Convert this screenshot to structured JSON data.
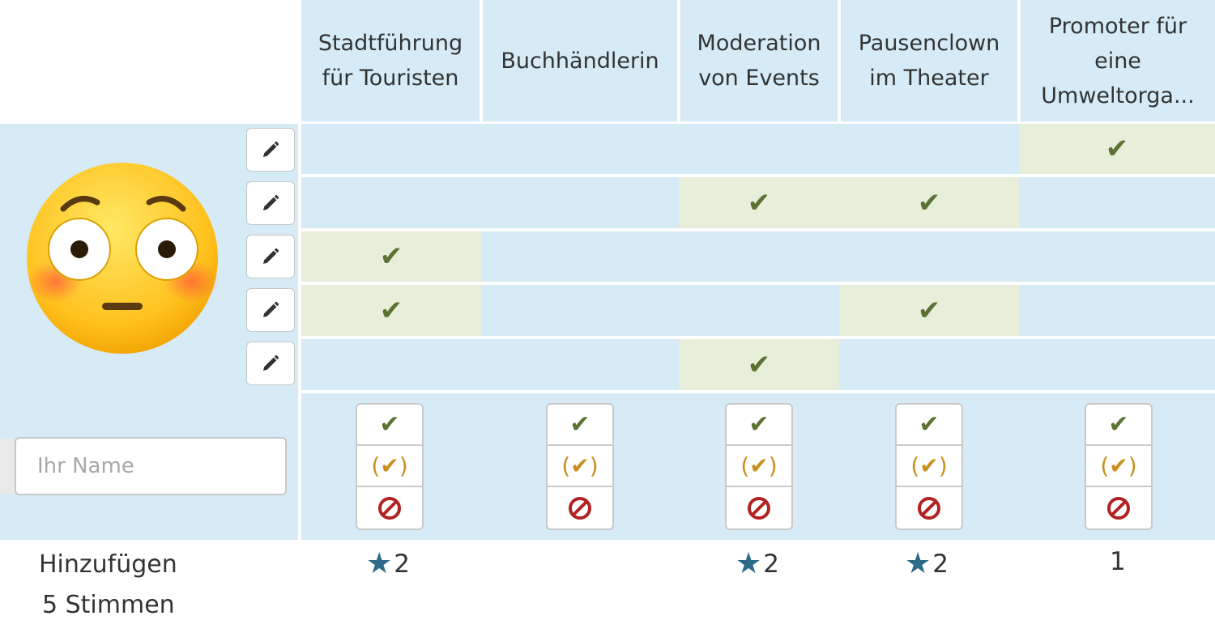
{
  "columns": [
    {
      "label": "Stadtführung für Touristen",
      "count": "2",
      "top": true
    },
    {
      "label": "Buchhändlerin",
      "count": "",
      "top": false
    },
    {
      "label": "Moderation von Events",
      "count": "2",
      "top": true
    },
    {
      "label": "Pausenclown im Theater",
      "count": "2",
      "top": true
    },
    {
      "label": "Promoter für eine Umweltorga...",
      "count": "1",
      "top": false
    }
  ],
  "votes": [
    [
      false,
      false,
      false,
      false,
      true
    ],
    [
      false,
      false,
      true,
      true,
      false
    ],
    [
      true,
      false,
      false,
      false,
      false
    ],
    [
      true,
      false,
      false,
      true,
      false
    ],
    [
      false,
      false,
      true,
      false,
      false
    ]
  ],
  "form": {
    "name_placeholder": "Ihr Name",
    "choice_yes": "✔",
    "choice_maybe": "(✔)",
    "choice_no_icon": "forbidden-icon"
  },
  "footer": {
    "add_label": "Hinzufügen",
    "votes_label": "5 Stimmen"
  },
  "icons": {
    "edit": "pencil-icon",
    "avatar": "flushed-face-emoji",
    "star": "star-icon"
  },
  "colors": {
    "header_bg": "#d6ebf5",
    "yes_cell_bg": "#e7eed9",
    "check_green": "#5a7332",
    "maybe_orange": "#c98f1f",
    "no_red": "#b22222",
    "star_blue": "#2c6b8a"
  }
}
